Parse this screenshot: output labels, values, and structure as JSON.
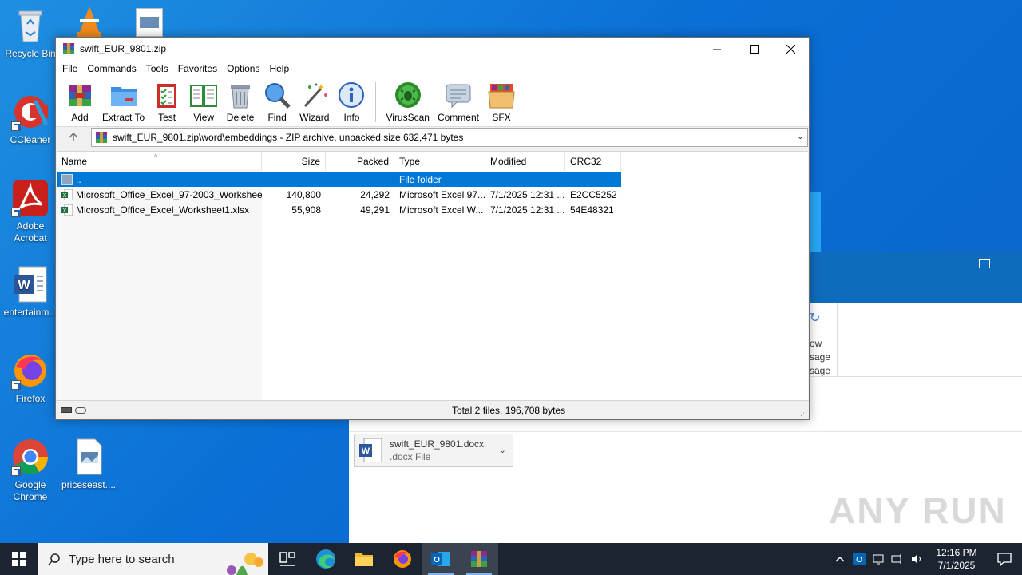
{
  "desktop": {
    "icons": [
      {
        "label": "Recycle Bin"
      },
      {
        "label": "CCleaner"
      },
      {
        "label": "Adobe Acrobat"
      },
      {
        "label": "entertainm..."
      },
      {
        "label": "Firefox"
      },
      {
        "label": "Google Chrome"
      },
      {
        "label": "priceseast...."
      }
    ]
  },
  "winrar": {
    "title": "swift_EUR_9801.zip",
    "menu": [
      "File",
      "Commands",
      "Tools",
      "Favorites",
      "Options",
      "Help"
    ],
    "toolbar": [
      "Add",
      "Extract To",
      "Test",
      "View",
      "Delete",
      "Find",
      "Wizard",
      "Info",
      "VirusScan",
      "Comment",
      "SFX"
    ],
    "address": "swift_EUR_9801.zip\\word\\embeddings - ZIP archive, unpacked size 632,471 bytes",
    "columns": {
      "name": "Name",
      "size": "Size",
      "packed": "Packed",
      "type": "Type",
      "modified": "Modified",
      "crc": "CRC32"
    },
    "rows": [
      {
        "name": "..",
        "size": "",
        "packed": "",
        "type": "File folder",
        "modified": "",
        "crc": ""
      },
      {
        "name": "Microsoft_Office_Excel_97-2003_Workshee...",
        "size": "140,800",
        "packed": "24,292",
        "type": "Microsoft Excel 97...",
        "modified": "7/1/2025 12:31 ...",
        "crc": "E2CC5252"
      },
      {
        "name": "Microsoft_Office_Excel_Worksheet1.xlsx",
        "size": "55,908",
        "packed": "49,291",
        "type": "Microsoft Excel W...",
        "modified": "7/1/2025 12:31 ...",
        "crc": "54E48321"
      }
    ],
    "status": "Total 2 files, 196,708 bytes"
  },
  "outlook": {
    "attachment_name": "swift_EUR_9801.docx",
    "attachment_type": ".docx File",
    "ribbon_text_1": "ow",
    "ribbon_text_2": "sage",
    "ribbon_text_3": "sage"
  },
  "taskbar": {
    "search_placeholder": "Type here to search",
    "time": "12:16 PM",
    "date": "7/1/2025"
  },
  "watermark": "ANY RUN",
  "colors": {
    "selection": "#0078d7",
    "desktop": "#0b63c9",
    "taskbar": "#1c2431"
  }
}
